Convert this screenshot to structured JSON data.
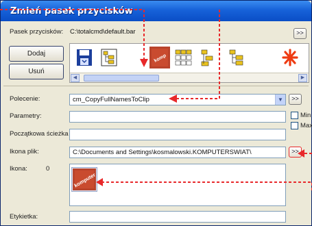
{
  "window": {
    "title": "Zmień pasek przycisków"
  },
  "toolbar_file": {
    "label": "Pasek przycisków:",
    "value": "C:\\totalcmd\\default.bar",
    "browse_label": ">>"
  },
  "buttons": {
    "add_label": "Dodaj",
    "delete_label": "Usuń"
  },
  "toolbar_icons": [
    {
      "name": "floppy-save-icon"
    },
    {
      "name": "tree-view-icon"
    },
    {
      "name": "blank-slot"
    },
    {
      "name": "komputer-swiat-icon"
    },
    {
      "name": "multi-folder-icon"
    },
    {
      "name": "folder-tree-icon"
    },
    {
      "name": "folder-tree-icon-2"
    },
    {
      "name": "asterisk-icon"
    }
  ],
  "command": {
    "label": "Polecenie:",
    "value": "cm_CopyFullNamesToClip",
    "browse_label": ">>"
  },
  "parameters": {
    "label": "Parametry:",
    "value": ""
  },
  "start_path": {
    "label": "Początkowa ścieżka:",
    "value": ""
  },
  "checkboxes": [
    {
      "label": "Min"
    },
    {
      "label": "Max"
    }
  ],
  "icon_file": {
    "label": "Ikona plik:",
    "value": "C:\\Documents and Settings\\kosmalowski.KOMPUTERSWIAT\\",
    "browse_label": ">>"
  },
  "icon": {
    "label": "Ikona:",
    "index": "0",
    "image_text": "komputer"
  },
  "tooltip": {
    "label": "Etykietka:",
    "value": ""
  },
  "colors": {
    "accent_red": "#e8282a",
    "title_blue": "#1762d9",
    "window_bg": "#ece9d8"
  }
}
